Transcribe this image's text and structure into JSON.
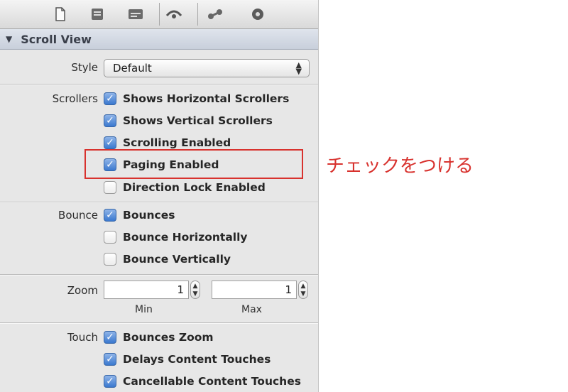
{
  "toolbar": {
    "icons": [
      "file-icon",
      "quick-help-icon",
      "identity-icon",
      "attributes-icon",
      "connections-icon",
      "size-icon"
    ]
  },
  "section": {
    "title": "Scroll View",
    "toggle_glyph": "▼"
  },
  "style": {
    "label": "Style",
    "value": "Default"
  },
  "scrollers": {
    "label": "Scrollers",
    "items": [
      {
        "label": "Shows Horizontal Scrollers",
        "checked": true
      },
      {
        "label": "Shows Vertical Scrollers",
        "checked": true
      },
      {
        "label": "Scrolling Enabled",
        "checked": true
      },
      {
        "label": "Paging Enabled",
        "checked": true
      },
      {
        "label": "Direction Lock Enabled",
        "checked": false
      }
    ]
  },
  "bounce": {
    "label": "Bounce",
    "items": [
      {
        "label": "Bounces",
        "checked": true
      },
      {
        "label": "Bounce Horizontally",
        "checked": false
      },
      {
        "label": "Bounce Vertically",
        "checked": false
      }
    ]
  },
  "zoom": {
    "label": "Zoom",
    "min_value": "1",
    "max_value": "1",
    "min_label": "Min",
    "max_label": "Max"
  },
  "touch": {
    "label": "Touch",
    "items": [
      {
        "label": "Bounces Zoom",
        "checked": true
      },
      {
        "label": "Delays Content Touches",
        "checked": true
      },
      {
        "label": "Cancellable Content Touches",
        "checked": true
      }
    ]
  },
  "annotation": {
    "text": "チェックをつける",
    "color": "#d8322e"
  },
  "colors": {
    "checkbox_on": "#3a78cf",
    "highlight": "#d8322e"
  }
}
